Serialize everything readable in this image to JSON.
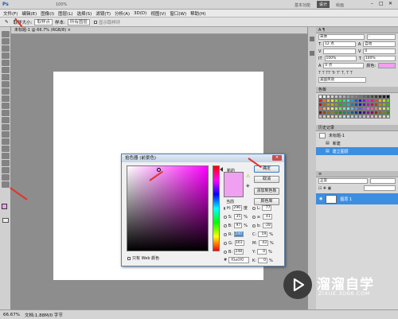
{
  "titlebar": {
    "zoom": "100%",
    "workspace": "基本功能",
    "design": "设计",
    "draw": "绘画"
  },
  "menu": [
    "文件(F)",
    "编辑(E)",
    "图像(I)",
    "图层(L)",
    "选择(S)",
    "滤镜(T)",
    "分析(A)",
    "3D(D)",
    "视图(V)",
    "窗口(W)",
    "帮助(H)"
  ],
  "options": {
    "sample_size_label": "取样大小:",
    "sample_size_value": "取样点",
    "sample_label": "样本:",
    "sample_value": "所有图层",
    "ring_label": "显示取样环"
  },
  "document": {
    "tab": "未标题-1 @ 66.7% (RGB/8) ×"
  },
  "status": {
    "zoom": "66.67%",
    "doc": "文档:1.88M/0 字节"
  },
  "panels": {
    "char_font": "宋体",
    "char_size": "12 点",
    "char_leading": "自动",
    "char_tracking": "0",
    "char_scale_v": "100%",
    "char_scale_h": "100%",
    "char_baseline": "0 点",
    "char_color_label": "颜色:",
    "language": "美国英语",
    "swatches_tab": "色板",
    "history_tab": "历史记录",
    "history_doc": "未标题-1",
    "history_items": [
      "新建",
      "建立图层"
    ],
    "layers_mode": "正常",
    "layer_name": "图层 1"
  },
  "picker": {
    "title": "拾色器 (前景色)",
    "close": "✕",
    "new_label": "新的",
    "current_label": "当前",
    "ok": "确定",
    "cancel": "取消",
    "add_swatch": "添加到色板",
    "libraries": "颜色库",
    "web_only": "只有 Web 颜色",
    "hex_label": "#",
    "hex": "f0a0f0",
    "new_color": "#f0a0f0",
    "current_color": "#f0a0f0",
    "hsb": [
      {
        "label": "H:",
        "value": "296",
        "unit": "度"
      },
      {
        "label": "S:",
        "value": "35",
        "unit": "%"
      },
      {
        "label": "B:",
        "value": "97",
        "unit": "%"
      }
    ],
    "rgb": [
      {
        "label": "R:",
        "value": "240"
      },
      {
        "label": "G:",
        "value": "161"
      },
      {
        "label": "B:",
        "value": "248"
      }
    ],
    "lab": [
      {
        "label": "L:",
        "value": "77"
      },
      {
        "label": "a:",
        "value": "41"
      },
      {
        "label": "b:",
        "value": "-28"
      }
    ],
    "cmyk": [
      {
        "label": "C:",
        "value": "19",
        "unit": "%"
      },
      {
        "label": "M:",
        "value": "43",
        "unit": "%"
      },
      {
        "label": "Y:",
        "value": "0",
        "unit": "%"
      },
      {
        "label": "K:",
        "value": "0",
        "unit": "%"
      }
    ]
  },
  "toolbox": {
    "foreground": "#f0a0f0",
    "background": "#2ecc40"
  },
  "watermark": {
    "title": "溜溜自学",
    "url": "ZIXUE.3D66.COM"
  },
  "colors": {
    "annotation": "#e0352b",
    "accent": "#3c8ee0"
  }
}
